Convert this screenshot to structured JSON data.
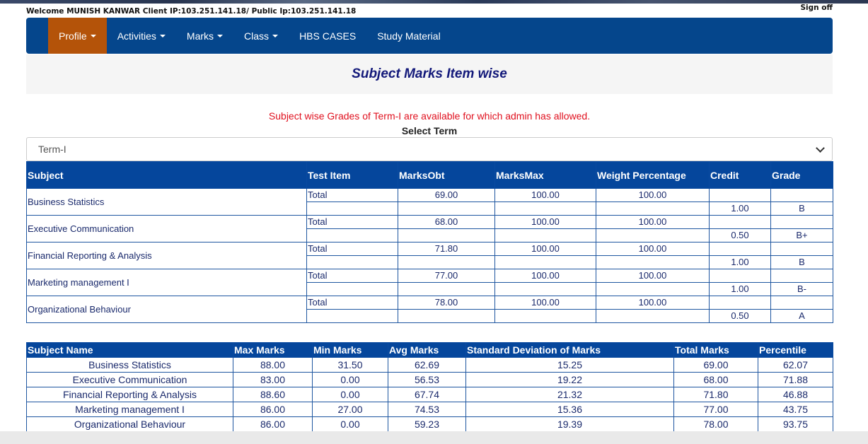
{
  "header": {
    "welcome": "Welcome MUNISH KANWAR Client IP:103.251.141.18/ Public Ip:103.251.141.18",
    "signoff": "Sign off"
  },
  "nav": {
    "items": [
      {
        "label": "Profile",
        "dropdown": true,
        "active": true
      },
      {
        "label": "Activities",
        "dropdown": true
      },
      {
        "label": "Marks",
        "dropdown": true
      },
      {
        "label": "Class",
        "dropdown": true
      },
      {
        "label": "HBS CASES",
        "dropdown": false
      },
      {
        "label": "Study Material",
        "dropdown": false
      }
    ],
    "accent": "#05468c",
    "active_color": "#b45309"
  },
  "page": {
    "title": "Subject Marks Item wise",
    "notice": "Subject wise Grades of Term-I are available for which admin has allowed.",
    "select_label": "Select Term",
    "select_value": "Term-I"
  },
  "marks_table": {
    "headers": [
      "Subject",
      "Test Item",
      "MarksObt",
      "MarksMax",
      "Weight Percentage",
      "Credit",
      "Grade"
    ],
    "rows": [
      {
        "subject": "Business Statistics",
        "item": "Total",
        "obt": "69.00",
        "max": "100.00",
        "weight": "100.00",
        "credit": "1.00",
        "grade": "B"
      },
      {
        "subject": "Executive Communication",
        "item": "Total",
        "obt": "68.00",
        "max": "100.00",
        "weight": "100.00",
        "credit": "0.50",
        "grade": "B+"
      },
      {
        "subject": "Financial Reporting & Analysis",
        "item": "Total",
        "obt": "71.80",
        "max": "100.00",
        "weight": "100.00",
        "credit": "1.00",
        "grade": "B"
      },
      {
        "subject": "Marketing management I",
        "item": "Total",
        "obt": "77.00",
        "max": "100.00",
        "weight": "100.00",
        "credit": "1.00",
        "grade": "B-"
      },
      {
        "subject": "Organizational Behaviour",
        "item": "Total",
        "obt": "78.00",
        "max": "100.00",
        "weight": "100.00",
        "credit": "0.50",
        "grade": "A"
      }
    ]
  },
  "stats_table": {
    "headers": [
      "Subject Name",
      "Max Marks",
      "Min Marks",
      "Avg Marks",
      "Standard Deviation of Marks",
      "Total Marks",
      "Percentile"
    ],
    "rows": [
      [
        "Business Statistics",
        "88.00",
        "31.50",
        "62.69",
        "15.25",
        "69.00",
        "62.07"
      ],
      [
        "Executive Communication",
        "83.00",
        "0.00",
        "56.53",
        "19.22",
        "68.00",
        "71.88"
      ],
      [
        "Financial Reporting & Analysis",
        "88.60",
        "0.00",
        "67.74",
        "21.32",
        "71.80",
        "46.88"
      ],
      [
        "Marketing management I",
        "86.00",
        "27.00",
        "74.53",
        "15.36",
        "77.00",
        "43.75"
      ],
      [
        "Organizational Behaviour",
        "86.00",
        "0.00",
        "59.23",
        "19.39",
        "78.00",
        "93.75"
      ]
    ]
  }
}
